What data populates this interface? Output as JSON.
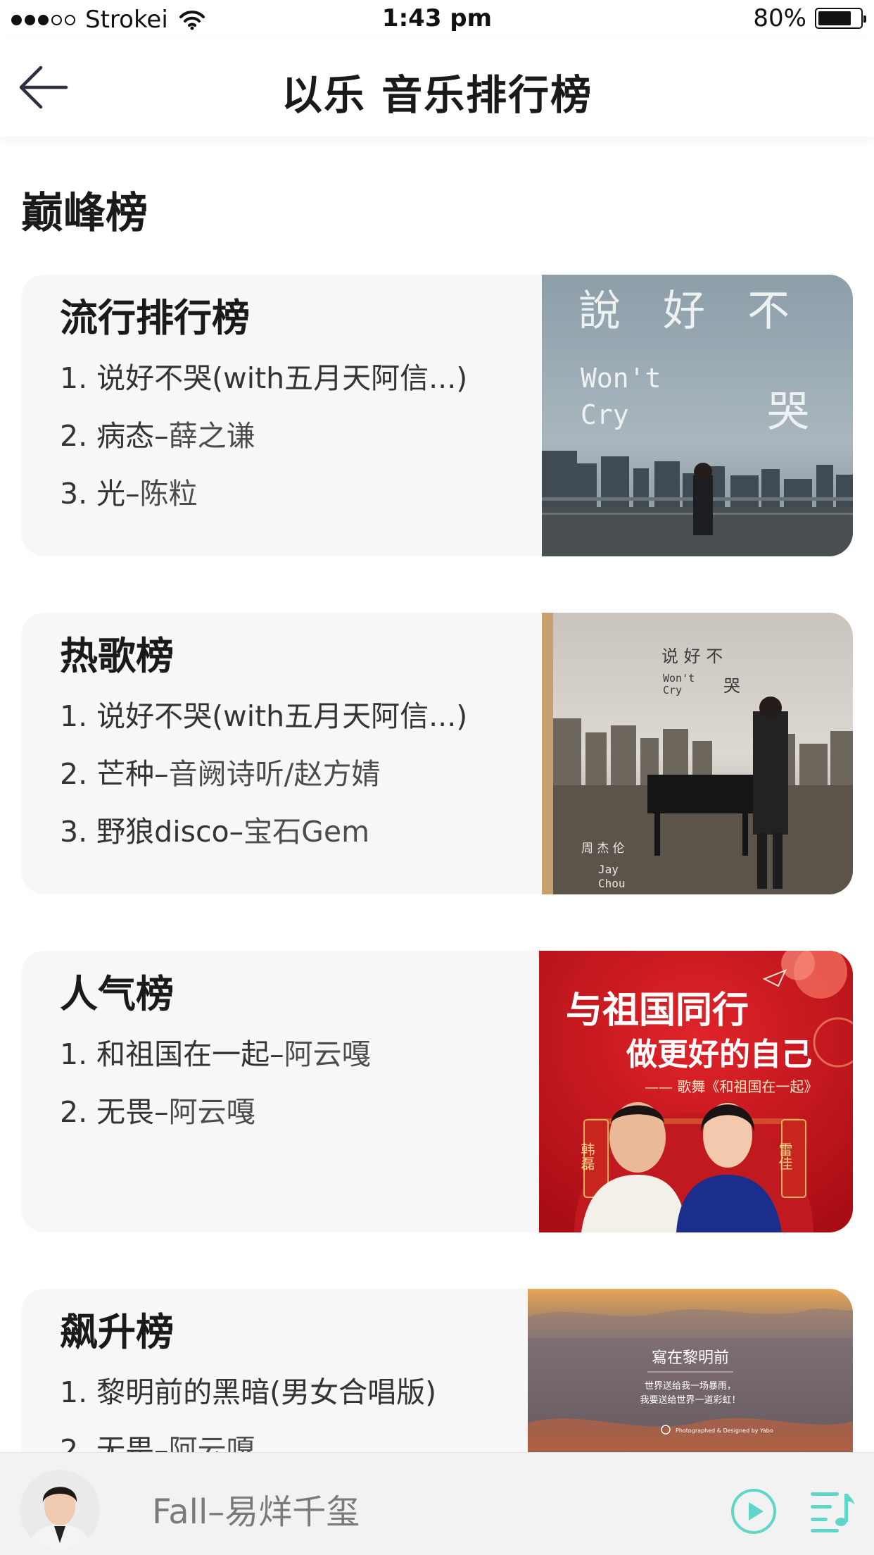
{
  "status_bar": {
    "carrier": "Strokei",
    "time": "1:43 pm",
    "battery_percent_text": "80%",
    "battery_level": 0.8,
    "signal_bars": 3,
    "signal_total": 5
  },
  "nav": {
    "title": "以乐 音乐排行榜",
    "back_icon": "arrow-left-icon"
  },
  "section_title": "巅峰榜",
  "charts": [
    {
      "title": "流行排行榜",
      "tracks": [
        {
          "num": "1.",
          "song": "说好不哭(with五月天阿信...)",
          "artist": ""
        },
        {
          "num": "2.",
          "song": "病态",
          "sep": "–",
          "artist": "薛之谦"
        },
        {
          "num": "3.",
          "song": "光",
          "sep": "–",
          "artist": "陈粒"
        }
      ],
      "cover": {
        "title_line1": "說　好　不",
        "title_line2": "哭",
        "subtitle_line1": "Won't",
        "subtitle_line2": "Cry"
      }
    },
    {
      "title": "热歌榜",
      "tracks": [
        {
          "num": "1.",
          "song": "说好不哭(with五月天阿信...)",
          "artist": ""
        },
        {
          "num": "2.",
          "song": "芒种",
          "sep": "–",
          "artist": "音阙诗听/赵方婧"
        },
        {
          "num": "3.",
          "song": "野狼disco",
          "sep": "–",
          "artist": "宝石Gem"
        }
      ],
      "cover": {
        "title_line1": "说 好 不",
        "title_line2": "哭",
        "subtitle_line1": "Won't",
        "subtitle_line2": "Cry",
        "artist_zh": "周 杰 伦",
        "artist_en_line1": "Jay",
        "artist_en_line2": "Chou"
      }
    },
    {
      "title": "人气榜",
      "tracks": [
        {
          "num": "1.",
          "song": "和祖国在一起",
          "sep": "–",
          "artist": "阿云嘎"
        },
        {
          "num": "2.",
          "song": "无畏",
          "sep": "–",
          "artist": "阿云嘎"
        }
      ],
      "cover": {
        "headline1": "与祖国同行",
        "headline2": "做更好的自己",
        "tagline": "—— 歌舞《和祖国在一起》",
        "name_left": "韩磊",
        "name_right": "雷佳"
      }
    },
    {
      "title": "飙升榜",
      "tracks": [
        {
          "num": "1.",
          "song": "黎明前的黑暗(男女合唱版)",
          "artist": ""
        },
        {
          "num": "2.",
          "song": "无畏",
          "sep": "–",
          "artist": "阿云嘎"
        }
      ],
      "cover": {
        "title": "寫在黎明前",
        "line1": "世界送给我一场暴雨，",
        "line2": "我要送给世界一道彩虹！",
        "credit": "Photographed & Designed by Yabo"
      }
    }
  ],
  "player": {
    "now_playing": "Fall–易烊千玺",
    "play_icon": "play-circle-icon",
    "playlist_icon": "playlist-music-icon",
    "accent_color": "#5fd6c8"
  }
}
